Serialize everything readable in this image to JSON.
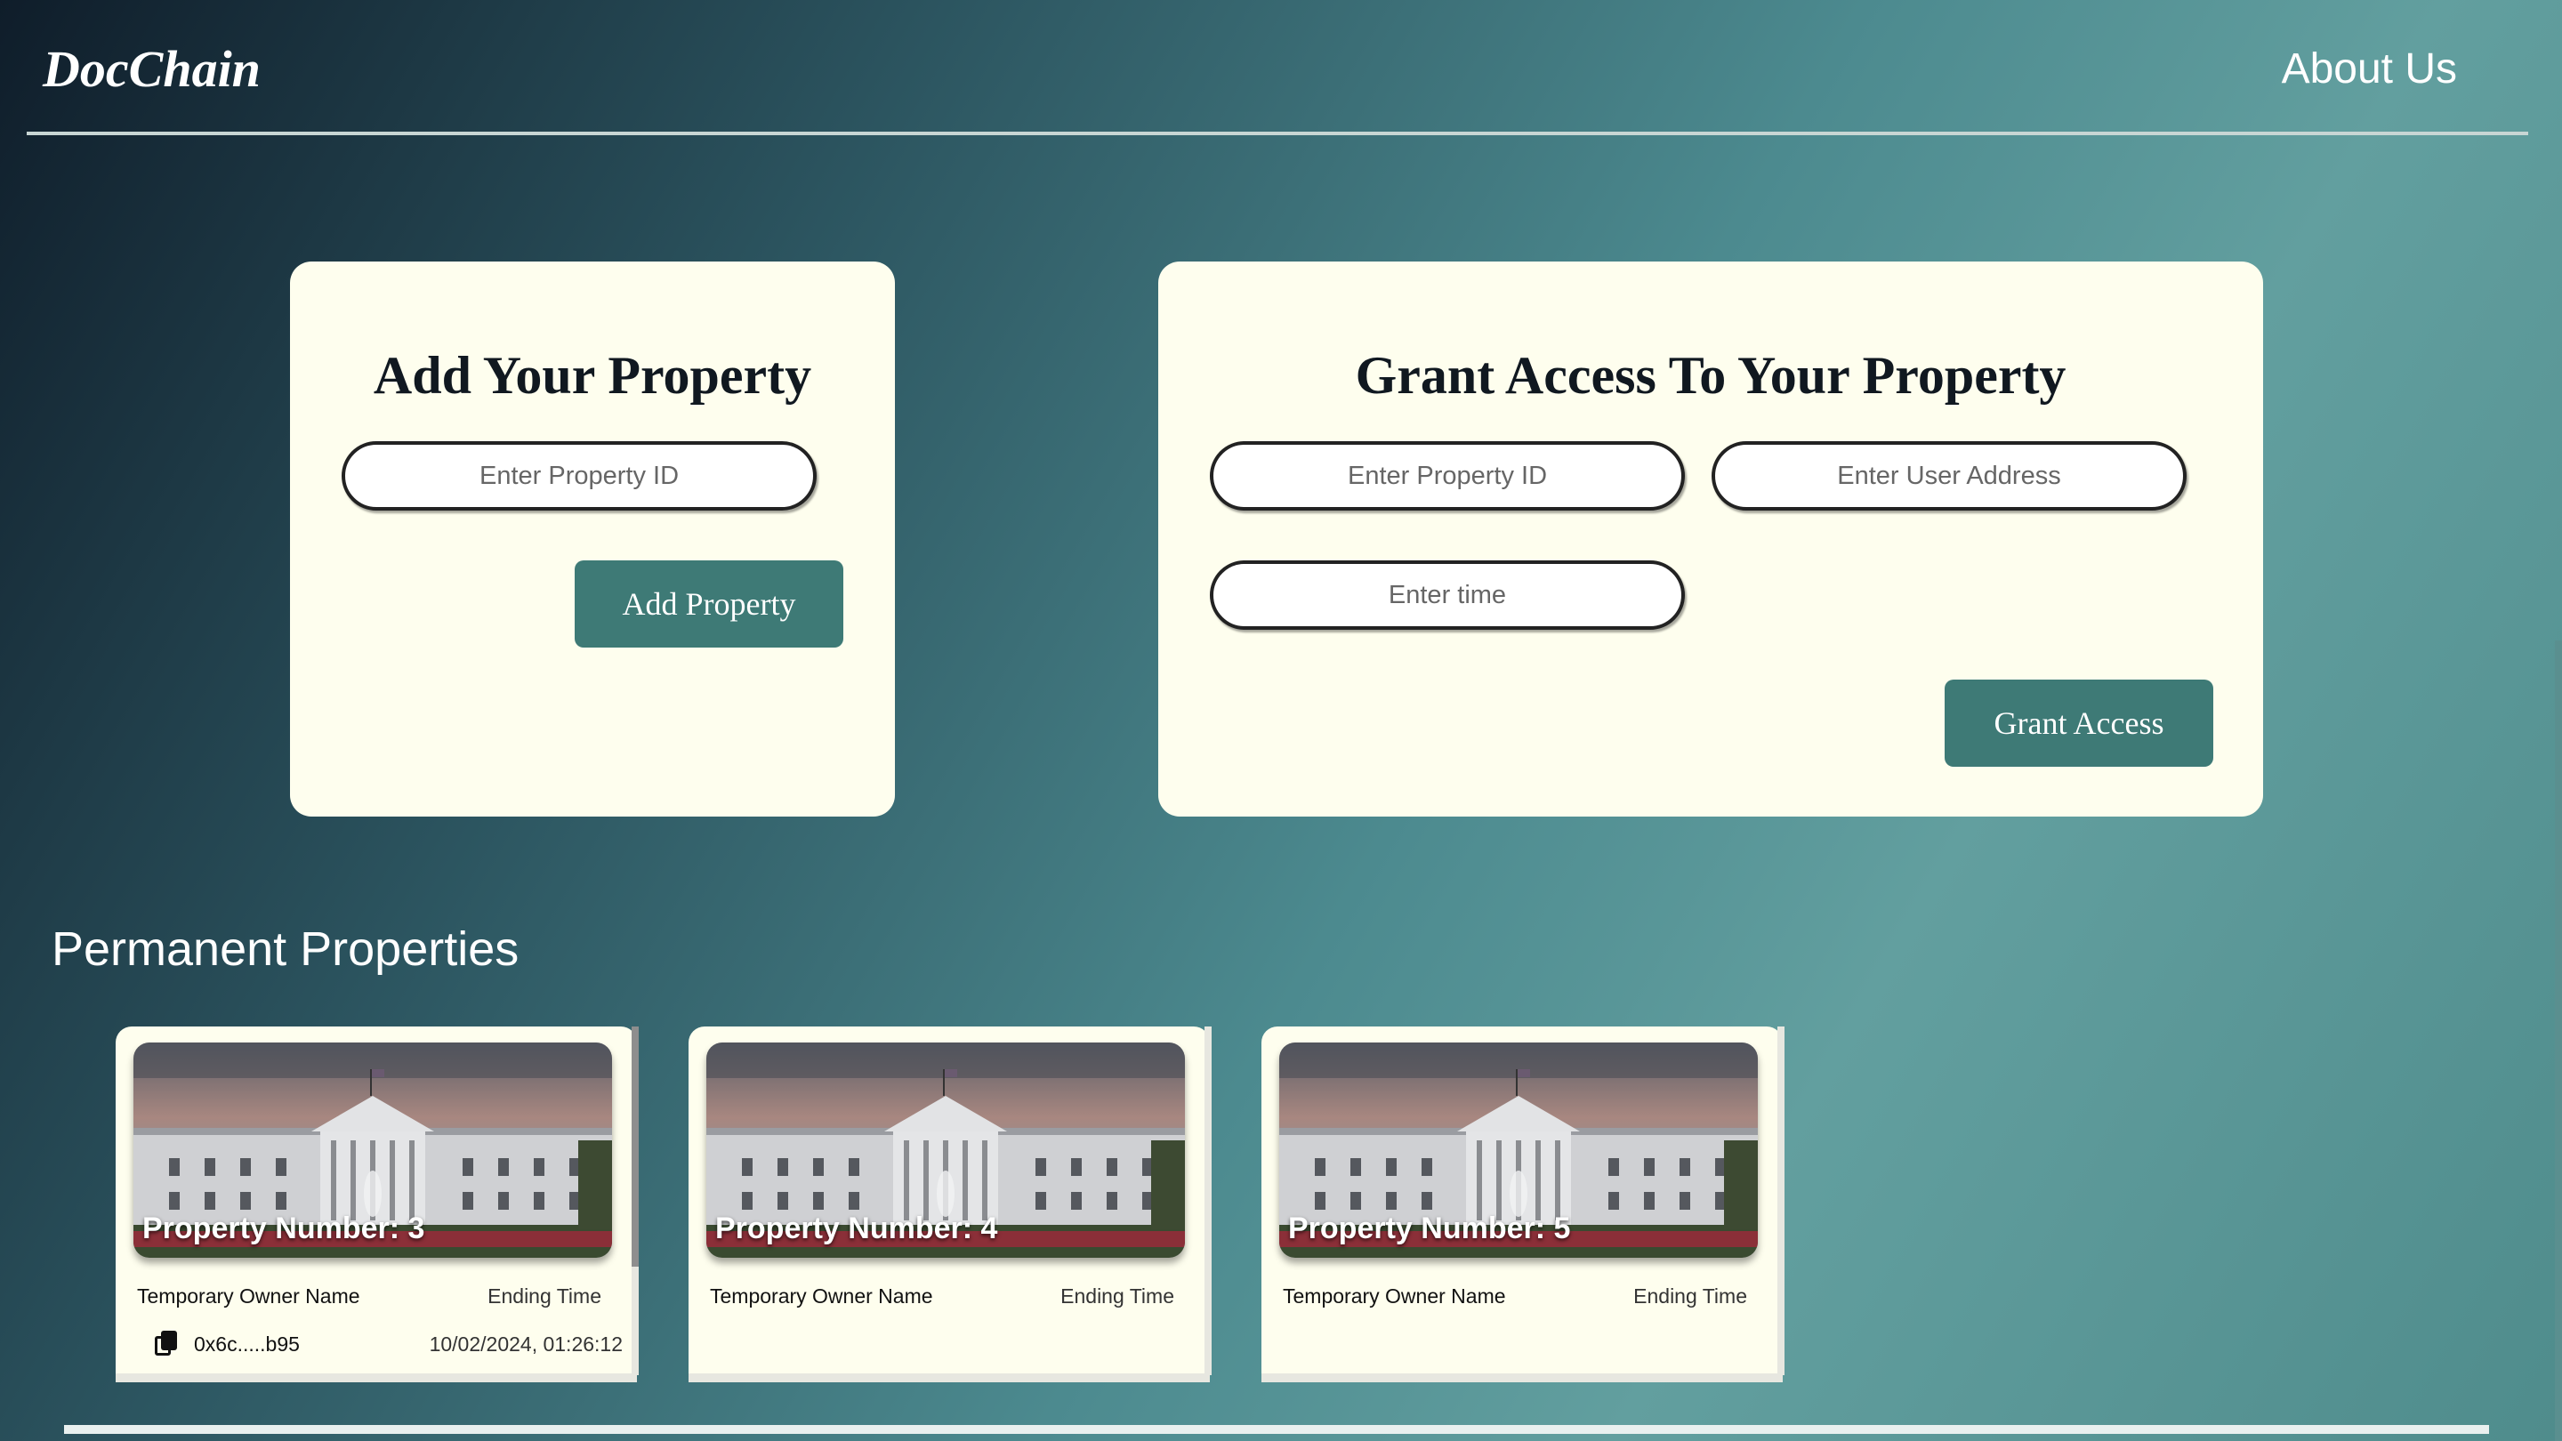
{
  "header": {
    "brand": "DocChain",
    "about_label": "About Us"
  },
  "add_card": {
    "title": "Add Your Property",
    "property_id_placeholder": "Enter Property ID",
    "button_label": "Add Property"
  },
  "grant_card": {
    "title": "Grant Access To Your Property",
    "property_id_placeholder": "Enter Property ID",
    "user_address_placeholder": "Enter User Address",
    "time_placeholder": "Enter time",
    "button_label": "Grant Access"
  },
  "permanent": {
    "title": "Permanent Properties",
    "cards": [
      {
        "number": "Property Number: 3",
        "owner_label": "Temporary Owner Name",
        "end_label": "Ending Time",
        "owner": "0x6c.....b95",
        "ending": "10/02/2024, 01:26:12"
      },
      {
        "number": "Property Number: 4",
        "owner_label": "Temporary Owner Name",
        "end_label": "Ending Time"
      },
      {
        "number": "Property Number: 5",
        "owner_label": "Temporary Owner Name",
        "end_label": "Ending Time"
      }
    ]
  },
  "colors": {
    "card_bg": "#fefeee",
    "button": "#3e7a76"
  }
}
